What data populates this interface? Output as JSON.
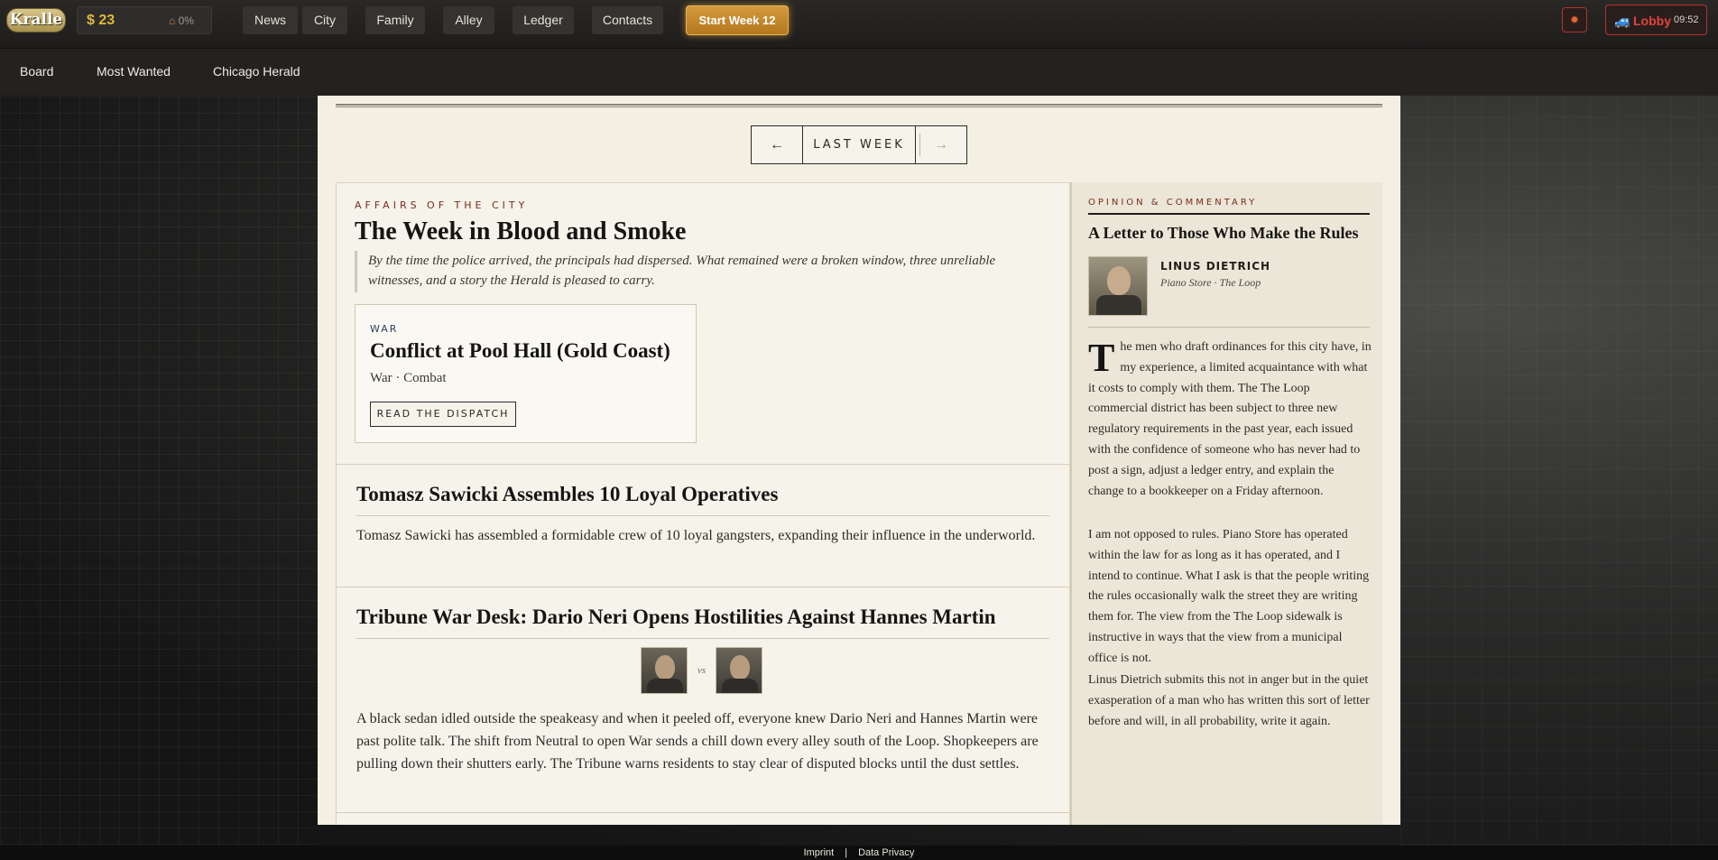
{
  "topbar": {
    "logo": "Kralle",
    "money": "$ 23",
    "heat_icon": "house-icon",
    "heat_pct": "0%",
    "nav": [
      "News",
      "City",
      "Family",
      "Alley",
      "Ledger",
      "Contacts"
    ],
    "start_week": "Start Week 12",
    "bug_icon": "bug-icon",
    "lobby_icon": "car-icon",
    "lobby": "Lobby",
    "clock": "09:52"
  },
  "subnav": {
    "items": [
      "Board",
      "Most Wanted",
      "Chicago Herald"
    ]
  },
  "weeknav": {
    "prev": "←",
    "label": "LAST WEEK",
    "next": "→"
  },
  "lead": {
    "kicker": "AFFAIRS OF THE CITY",
    "headline": "The Week in Blood and Smoke",
    "dek": "By the time the police arrived, the principals had dispersed. What remained were a broken window, three unreliable witnesses, and a story the Herald is pleased to carry.",
    "war_card": {
      "tag": "WAR",
      "title": "Conflict at Pool Hall (Gold Coast)",
      "subtitle": "War · Combat",
      "button": "READ THE DISPATCH"
    }
  },
  "stories": [
    {
      "headline": "Tomasz Sawicki Assembles 10 Loyal Operatives",
      "body": "Tomasz Sawicki has assembled a formidable crew of 10 loyal gangsters, expanding their influence in the underworld."
    },
    {
      "headline": "Tribune War Desk: Dario Neri Opens Hostilities Against Hannes Martin",
      "vs": "vs",
      "body": "A black sedan idled outside the speakeasy and when it peeled off, everyone knew Dario Neri and Hannes Martin were past polite talk. The shift from Neutral to open War sends a chill down every alley south of the Loop. Shopkeepers are pulling down their shutters early. The Tribune warns residents to stay clear of disputed blocks until the dust settles."
    }
  ],
  "sidebar": {
    "kicker": "OPINION & COMMENTARY",
    "title": "A Letter to Those Who Make the Rules",
    "author": "LINUS DIETRICH",
    "author_loc": "Piano Store · The Loop",
    "dropcap": "T",
    "para1": "he men who draft ordinances for this city have, in my experience, a limited acquaintance with what it costs to comply with them. The The Loop commercial district has been subject to three new regulatory requirements in the past year, each issued with the confidence of someone who has never had to post a sign, adjust a ledger entry, and explain the change to a bookkeeper on a Friday afternoon.",
    "para2": "I am not opposed to rules. Piano Store has operated within the law for as long as it has operated, and I intend to continue. What I ask is that the people writing the rules occasionally walk the street they are writing them for. The view from the The Loop sidewalk is instructive in ways that the view from a municipal office is not.",
    "para3": "Linus Dietrich submits this not in anger but in the quiet exasperation of a man who has written this sort of letter before and will, in all probability, write it again."
  },
  "footer": {
    "imprint": "Imprint",
    "sep": "|",
    "privacy": "Data Privacy"
  }
}
